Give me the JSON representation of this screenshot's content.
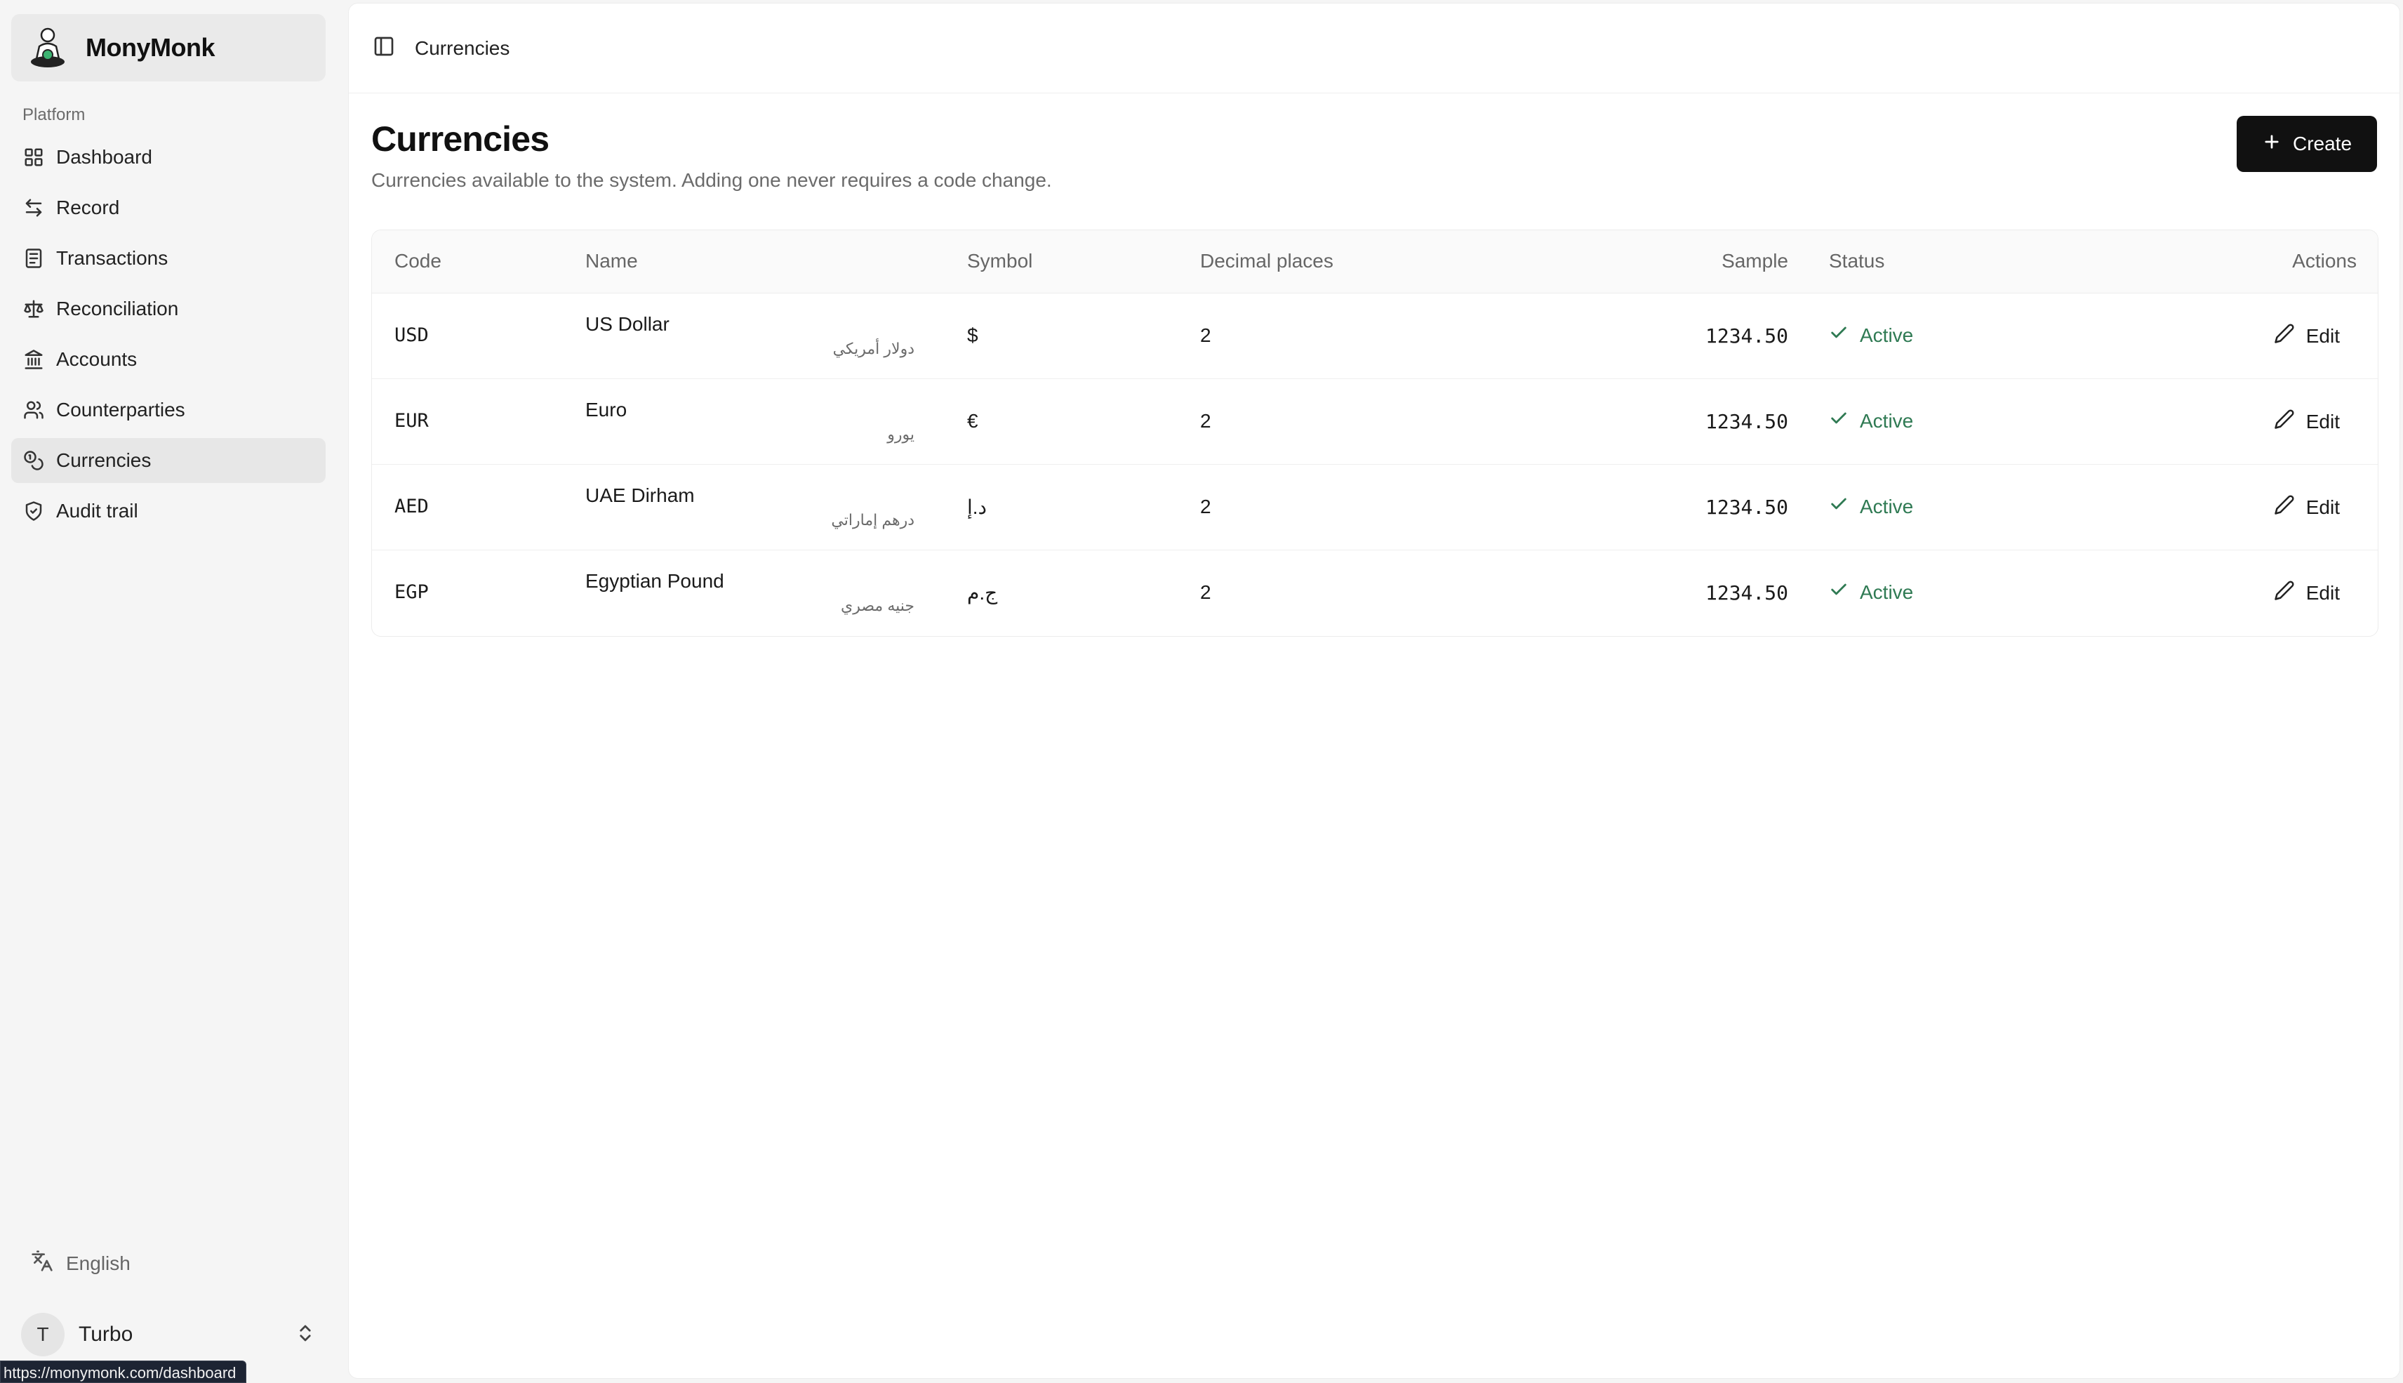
{
  "brand": {
    "name": "MonyMonk",
    "logo_icon": "monk-meditating-logo"
  },
  "sidebar": {
    "section_label": "Platform",
    "items": [
      {
        "label": "Dashboard",
        "icon": "grid-icon"
      },
      {
        "label": "Record",
        "icon": "arrows-left-right-icon"
      },
      {
        "label": "Transactions",
        "icon": "receipt-icon"
      },
      {
        "label": "Reconciliation",
        "icon": "scale-icon"
      },
      {
        "label": "Accounts",
        "icon": "bank-icon"
      },
      {
        "label": "Counterparties",
        "icon": "users-icon"
      },
      {
        "label": "Currencies",
        "icon": "coins-icon",
        "active": true
      },
      {
        "label": "Audit trail",
        "icon": "shield-check-icon"
      }
    ],
    "language": "English",
    "user": {
      "initial": "T",
      "name": "Turbo"
    }
  },
  "status_bar": {
    "url": "https://monymonk.com/dashboard"
  },
  "header": {
    "breadcrumb": "Currencies"
  },
  "page": {
    "title": "Currencies",
    "subtitle": "Currencies available to the system. Adding one never requires a code change.",
    "create_label": "Create"
  },
  "table": {
    "columns": {
      "code": "Code",
      "name": "Name",
      "symbol": "Symbol",
      "decimals": "Decimal places",
      "sample": "Sample",
      "status": "Status",
      "actions": "Actions"
    },
    "rows": [
      {
        "code": "USD",
        "name": "US Dollar",
        "native": "دولار أمريكي",
        "symbol": "$",
        "decimals": "2",
        "sample": "1234.50",
        "status": "Active",
        "action": "Edit"
      },
      {
        "code": "EUR",
        "name": "Euro",
        "native": "يورو",
        "symbol": "€",
        "decimals": "2",
        "sample": "1234.50",
        "status": "Active",
        "action": "Edit"
      },
      {
        "code": "AED",
        "name": "UAE Dirham",
        "native": "درهم إماراتي",
        "symbol": "د.إ",
        "decimals": "2",
        "sample": "1234.50",
        "status": "Active",
        "action": "Edit"
      },
      {
        "code": "EGP",
        "name": "Egyptian Pound",
        "native": "جنيه مصري",
        "symbol": "ج.م",
        "decimals": "2",
        "sample": "1234.50",
        "status": "Active",
        "action": "Edit"
      }
    ]
  },
  "colors": {
    "accent": "#111111",
    "active_status": "#2f7a53",
    "sidebar_bg": "#f5f5f5"
  }
}
